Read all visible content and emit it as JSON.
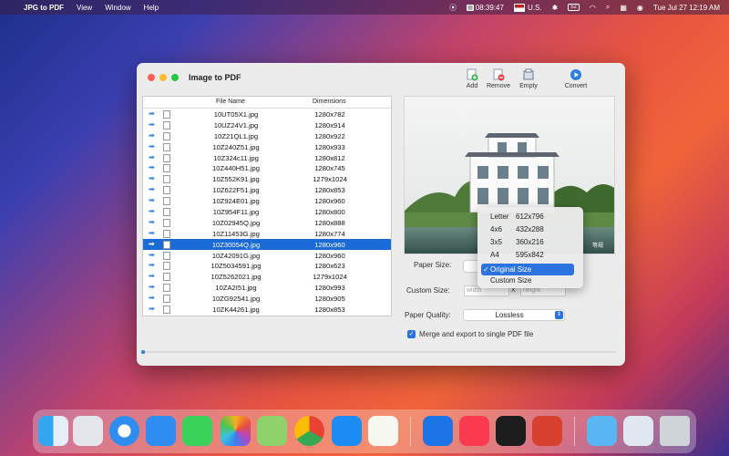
{
  "menubar": {
    "apple": "",
    "app_name": "JPG to PDF",
    "menus": [
      "View",
      "Window",
      "Help"
    ],
    "status": {
      "time_code": "08:39:47",
      "input": "U.S.",
      "battery": "52",
      "datetime": "Tue Jul 27  12:19 AM"
    }
  },
  "window": {
    "title": "Image to PDF",
    "toolbar": {
      "add": "Add",
      "remove": "Remove",
      "empty": "Empty",
      "convert": "Convert"
    },
    "columns": {
      "file": "File Name",
      "dim": "Dimensions"
    },
    "rows": [
      {
        "file": "10UT05X1.jpg",
        "dim": "1280x782"
      },
      {
        "file": "10UZ24V1.jpg",
        "dim": "1280x914"
      },
      {
        "file": "10Z21QL1.jpg",
        "dim": "1280x922"
      },
      {
        "file": "10Z240Z51.jpg",
        "dim": "1280x933"
      },
      {
        "file": "10Z324c11.jpg",
        "dim": "1280x812"
      },
      {
        "file": "10Z440H51.jpg",
        "dim": "1280x745"
      },
      {
        "file": "10Z552K91.jpg",
        "dim": "1279x1024"
      },
      {
        "file": "10Z622F51.jpg",
        "dim": "1280x853"
      },
      {
        "file": "10Z924E01.jpg",
        "dim": "1280x960"
      },
      {
        "file": "10Z954F11.jpg",
        "dim": "1280x800"
      },
      {
        "file": "10Z02945Q.jpg",
        "dim": "1280x888"
      },
      {
        "file": "10Z11453G.jpg",
        "dim": "1280x774"
      },
      {
        "file": "10Z30054Q.jpg",
        "dim": "1280x960"
      },
      {
        "file": "10Z42091G.jpg",
        "dim": "1280x960"
      },
      {
        "file": "10Z5034591.jpg",
        "dim": "1280x623"
      },
      {
        "file": "10Z5262021.jpg",
        "dim": "1279x1024"
      },
      {
        "file": "10ZA2I51.jpg",
        "dim": "1280x993"
      },
      {
        "file": "10ZG92541.jpg",
        "dim": "1280x905"
      },
      {
        "file": "10ZK44261.jpg",
        "dim": "1280x853"
      }
    ],
    "selected_index": 12,
    "preview_watermark": "等规",
    "paper_size_label": "Paper Size:",
    "custom_size_label": "Custom Size:",
    "width_placeholder": "width",
    "height_placeholder": "height",
    "x_sep": "X",
    "quality_label": "Paper Quality:",
    "quality_value": "Lossless",
    "merge_label": "Merge and export to single PDF file",
    "paper_options": [
      {
        "name": "Letter",
        "size": "612x796"
      },
      {
        "name": "4x6",
        "size": "432x288"
      },
      {
        "name": "3x5",
        "size": "360x216"
      },
      {
        "name": "A4",
        "size": "595x842"
      },
      {
        "name": "Original Size",
        "size": "",
        "checked": true
      },
      {
        "name": "Custom Size",
        "size": ""
      }
    ]
  },
  "colors": {
    "accent": "#1a6ad8",
    "window_bg": "#ececec"
  },
  "dock": [
    "Finder",
    "Launchpad",
    "Safari",
    "Mail",
    "Messages",
    "Photos",
    "Maps",
    "Chrome",
    "App Store",
    "TextEdit",
    "Xcode",
    "Music",
    "Terminal",
    "JPG to PDF",
    "Folder",
    "Preview",
    "Trash"
  ]
}
